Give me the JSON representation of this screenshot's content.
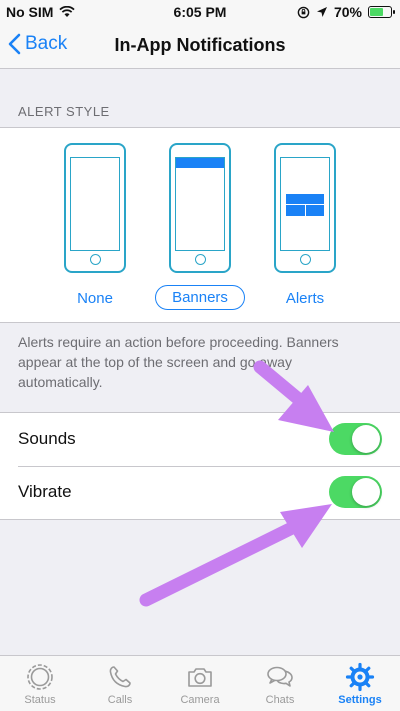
{
  "status_bar": {
    "carrier": "No SIM",
    "time": "6:05 PM",
    "battery": "70%",
    "battery_level": 0.7
  },
  "nav": {
    "back_label": "Back",
    "title": "In-App Notifications"
  },
  "alert_style": {
    "header": "ALERT STYLE",
    "options": [
      {
        "label": "None",
        "selected": false
      },
      {
        "label": "Banners",
        "selected": true
      },
      {
        "label": "Alerts",
        "selected": false
      }
    ],
    "description": "Alerts require an action before proceeding. Banners appear at the top of the screen and go away automatically."
  },
  "toggles": [
    {
      "label": "Sounds",
      "on": true
    },
    {
      "label": "Vibrate",
      "on": true
    }
  ],
  "tabs": [
    {
      "label": "Status",
      "icon": "status-icon",
      "active": false
    },
    {
      "label": "Calls",
      "icon": "phone-icon",
      "active": false
    },
    {
      "label": "Camera",
      "icon": "camera-icon",
      "active": false
    },
    {
      "label": "Chats",
      "icon": "chats-icon",
      "active": false
    },
    {
      "label": "Settings",
      "icon": "gear-icon",
      "active": true
    }
  ],
  "colors": {
    "accent": "#1a82f6",
    "switch_on": "#4cd964",
    "arrow": "#c77ff0"
  }
}
